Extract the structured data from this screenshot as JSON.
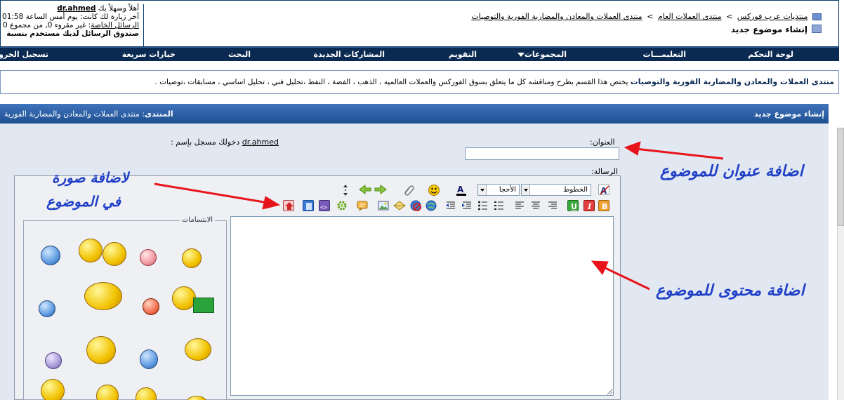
{
  "breadcrumb": {
    "items": [
      "منتديات عرب فوركس",
      "منتدى العملات العام",
      "منتدى العملات والمعادن والمضاربة الفورية والتوصيات"
    ],
    "separator": ">"
  },
  "page_title": "إنشاء موضوع جديد",
  "user": {
    "welcome": "أهلاً وسهلاً بك",
    "username": "dr.ahmed",
    "last_visit": "آخر زيارة لك كانت: يوم أمس الساعة 01:58",
    "pm_label": "الرسائل الخاصة",
    "pm_text": ": غير مقروء 0, من مجموع 0",
    "pm_usage": "صندوق الرسائل لديك مستخدم بنسبة"
  },
  "nav": {
    "items": [
      "لوحة التحكم",
      "التعليمـــات",
      "المجموعات",
      "التقويم",
      "المشاركات الجديدة",
      "البحث",
      "خيارات سريعة",
      "تسجيل الخروج"
    ]
  },
  "forum_info": {
    "title": "منتدى العملات والمعادن والمضاربة الفورية والتوصيات",
    "description": "يختص هذا القسم بطرح ومناقشه كل ما يتعلق بسوق الفوركس والعملات العالميه ، الذهب ، الفضة ، النفط ،تحليل فني ، تحليل اساسي ، مسابقات ،توصيات ."
  },
  "form_header": {
    "right": "إنشاء موضوع جديد",
    "left_label": "المنتدى",
    "left_value": ": منتدى العملات والمعادن والمضاربة الفورية"
  },
  "form": {
    "title_label": "العنوان:",
    "title_value": "",
    "message_label": "الرسالة:",
    "logged_in_as": "دخولك مسجل بإسم :",
    "logged_in_user": "dr.ahmed"
  },
  "editor": {
    "font_select": "الخطوط",
    "size_select": "الأحجا",
    "smilies_legend": "الابتسامات"
  },
  "annotations": {
    "title_hint": "اضافة عنوان للموضوع",
    "image_hint_line1": "لاضافة صورة",
    "image_hint_line2": "في الموضوع",
    "content_hint": "اضافة محتوى للموضوع"
  },
  "colors": {
    "nav_bg": "#0a2a52",
    "header_bg": "#1d4f92",
    "panel_bg": "#e2e8f2",
    "annotation_text": "#1f3fc6",
    "annotation_arrow": "#e8141c"
  }
}
